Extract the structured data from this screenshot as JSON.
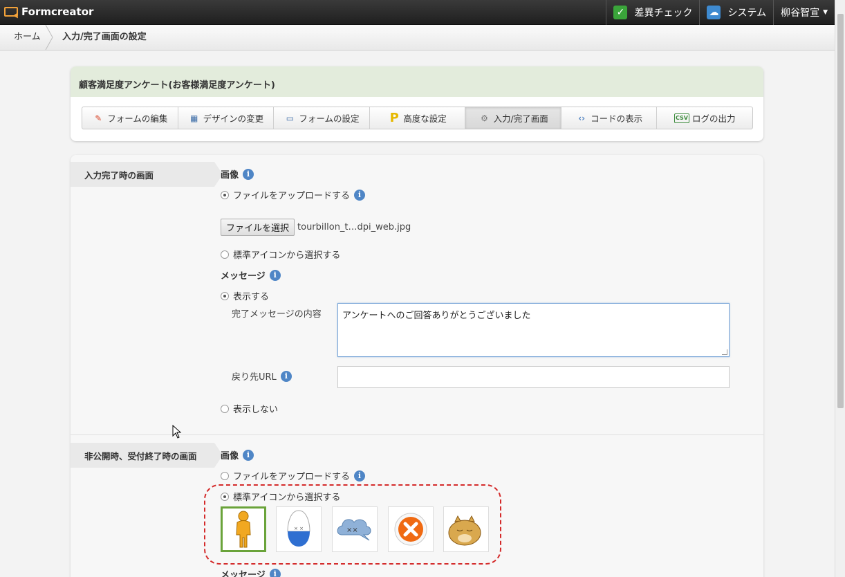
{
  "topbar": {
    "brand": "Formcreator",
    "diff_check": "差異チェック",
    "system": "システム",
    "user": "柳谷智宣"
  },
  "breadcrumb": {
    "home": "ホーム",
    "current": "入力/完了画面の設定"
  },
  "form": {
    "title": "顧客満足度アンケート(お客様満足度アンケート)",
    "tabs": [
      {
        "label": "フォームの編集",
        "icon": "pencil-icon"
      },
      {
        "label": "デザインの変更",
        "icon": "design-icon"
      },
      {
        "label": "フォームの設定",
        "icon": "monitor-icon"
      },
      {
        "label": "高度な設定",
        "icon": "p-icon"
      },
      {
        "label": "入力/完了画面",
        "icon": "gear-icon",
        "active": true
      },
      {
        "label": "コードの表示",
        "icon": "code-icon"
      },
      {
        "label": "ログの出力",
        "icon": "csv-icon"
      }
    ]
  },
  "completion_section": {
    "label": "入力完了時の画面",
    "image_title": "画像",
    "upload_option": "ファイルをアップロードする",
    "upload_selected": true,
    "file_button": "ファイルを選択",
    "file_name": "tourbillon_t…dpi_web.jpg",
    "standard_icon_option": "標準アイコンから選択する",
    "message_title": "メッセージ",
    "show_option": "表示する",
    "show_selected": true,
    "message_content_label": "完了メッセージの内容",
    "message_content_value": "アンケートへのご回答ありがとうございました",
    "return_url_label": "戻り先URL",
    "return_url_value": "",
    "hide_option": "表示しない"
  },
  "closed_section": {
    "label": "非公開時、受付終了時の画面",
    "image_title": "画像",
    "upload_option": "ファイルをアップロードする",
    "standard_icon_option": "標準アイコンから選択する",
    "standard_icon_selected": true,
    "icons": [
      "bowing-person-icon",
      "egg-character-icon",
      "dizzy-cloud-icon",
      "close-circle-icon",
      "sleeping-hamster-icon"
    ],
    "selected_icon_index": 0,
    "message_title": "メッセージ"
  },
  "colors": {
    "accent_green": "#6aa33a",
    "highlight_red": "#d42a2a",
    "info_blue": "#4f86c6"
  }
}
